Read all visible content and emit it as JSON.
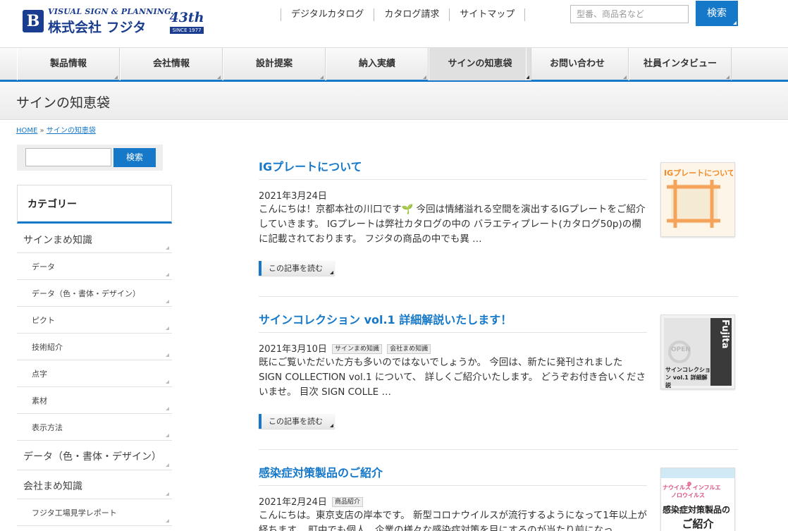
{
  "header": {
    "logo_sub": "VISUAL SIGN & PLANNING.",
    "logo_name": "株式会社 フジタ",
    "logo_mark": "B",
    "anniversary": "43th",
    "anniversary_since": "SINCE 1977",
    "links": [
      "デジタルカタログ",
      "カタログ請求",
      "サイトマップ"
    ],
    "search_placeholder": "型番、商品名など",
    "search_button": "検索"
  },
  "nav": {
    "items": [
      "製品情報",
      "会社情報",
      "設計提案",
      "納入実績",
      "サインの知恵袋",
      "お問い合わせ",
      "社員インタビュー"
    ],
    "active": "サインの知恵袋"
  },
  "page": {
    "title": "サインの知恵袋",
    "breadcrumb": {
      "home": "HOME",
      "sep": "»",
      "current": "サインの知恵袋"
    }
  },
  "sidebar": {
    "search_button": "検索",
    "category_heading": "カテゴリー",
    "items": [
      {
        "label": "サインまめ知識",
        "level": 1
      },
      {
        "label": "データ",
        "level": 2
      },
      {
        "label": "データ（色・書体・デザイン）",
        "level": 2
      },
      {
        "label": "ピクト",
        "level": 2
      },
      {
        "label": "技術紹介",
        "level": 2
      },
      {
        "label": "点字",
        "level": 2
      },
      {
        "label": "素材",
        "level": 2
      },
      {
        "label": "表示方法",
        "level": 2
      },
      {
        "label": "データ（色・書体・デザイン）",
        "level": 1
      },
      {
        "label": "会社まめ知識",
        "level": 1
      },
      {
        "label": "フジタ工場見学レポート",
        "level": 2
      }
    ]
  },
  "articles": [
    {
      "title": "IGプレートについて",
      "date": "2021年3月24日",
      "tags": [],
      "excerpt": "こんにちは！京都本社の川口です🌱 今回は情緒溢れる空間を演出するIGプレートをご紹介していきます。 IGプレートは弊社カタログの中の バラエティプレート(カタログ50p)の欄に記載されております。 フジタの商品の中でも異 …",
      "read_more": "この記事を読む",
      "thumb_text": "IGプレートについて"
    },
    {
      "title": "サインコレクション vol.1 詳細解説いたします！",
      "date": "2021年3月10日",
      "tags": [
        "サインまめ知識",
        "会社まめ知識"
      ],
      "excerpt": "既にご覧いただいた方も多いのではないでしょうか。 今回は、新たに発刊されました SIGN COLLECTION vol.1 について、 詳しくご紹介いたします。 どうぞお付き合いくださいませ。 目次 SIGN COLLE …",
      "read_more": "この記事を読む",
      "thumb_text_top": "Fujita",
      "thumb_text_bottom": "サインコレクション vol.1 詳細解説",
      "thumb_text_open": "OPEN"
    },
    {
      "title": "感染症対策製品のご紹介",
      "date": "2021年2月24日",
      "tags": [
        "商品紹介"
      ],
      "excerpt": "こんにちは。東京支店の岸本です。 新型コロナウイルスが流行するようになって1年以上が経ちます。 町中でも個人、企業の様々な感染症対策を目にするのが当たり前になっ",
      "read_more": "この記事を読む",
      "thumb_text_words": [
        "ナウイルス",
        "インフルエ",
        "ノロウイルス"
      ],
      "thumb_text_main": "感染症対策製品の",
      "thumb_text_sub": "ご紹介"
    }
  ],
  "colors": {
    "accent": "#1578c9",
    "brand": "#1b3d8f"
  }
}
